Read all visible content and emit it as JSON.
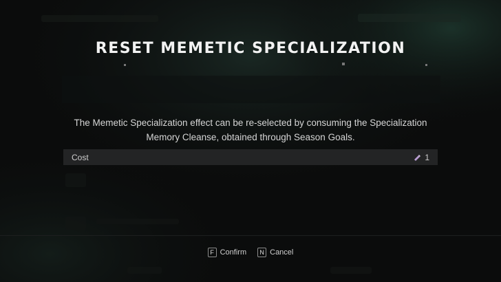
{
  "dialog": {
    "title": "RESET MEMETIC SPECIALIZATION",
    "message": "The Memetic Specialization effect can be re-selected by consuming the Specialization Memory Cleanse, obtained through Season Goals.",
    "cost": {
      "label": "Cost",
      "value": "1",
      "icon": "memory-cleanse-icon",
      "icon_color": "#b79ad0"
    }
  },
  "actions": {
    "confirm": {
      "key": "F",
      "label": "Confirm"
    },
    "cancel": {
      "key": "N",
      "label": "Cancel"
    }
  },
  "colors": {
    "background": "#0b0c0c",
    "row": "#232425",
    "accent_glow": "#1f3a30"
  }
}
